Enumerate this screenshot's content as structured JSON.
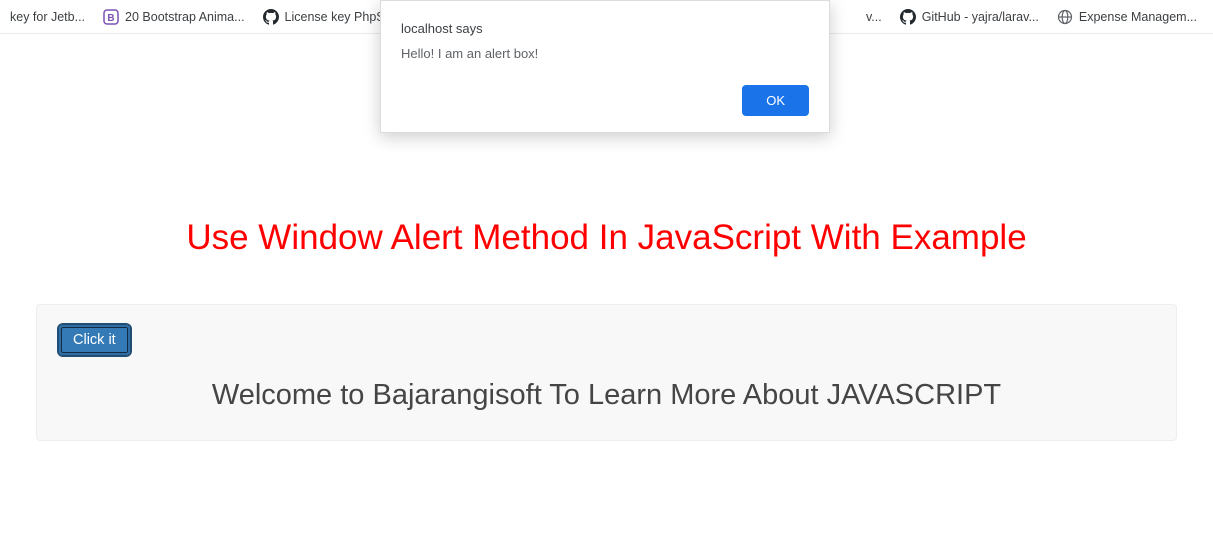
{
  "bookmarks": [
    {
      "label": "key for Jetb...",
      "icon": "blank"
    },
    {
      "label": "20 Bootstrap Anima...",
      "icon": "bootstrap"
    },
    {
      "label": "License key PhpStor...",
      "icon": "github"
    },
    {
      "label": "v...",
      "icon": "blank"
    },
    {
      "label": "GitHub - yajra/larav...",
      "icon": "github"
    },
    {
      "label": "Expense Managem...",
      "icon": "globe"
    }
  ],
  "alert": {
    "host": "localhost says",
    "message": "Hello! I am an alert box!",
    "ok_label": "OK"
  },
  "page": {
    "title": "Use Window Alert Method In JavaScript With Example",
    "button_label": "Click it",
    "welcome": "Welcome to Bajarangisoft To Learn More About JAVASCRIPT"
  }
}
